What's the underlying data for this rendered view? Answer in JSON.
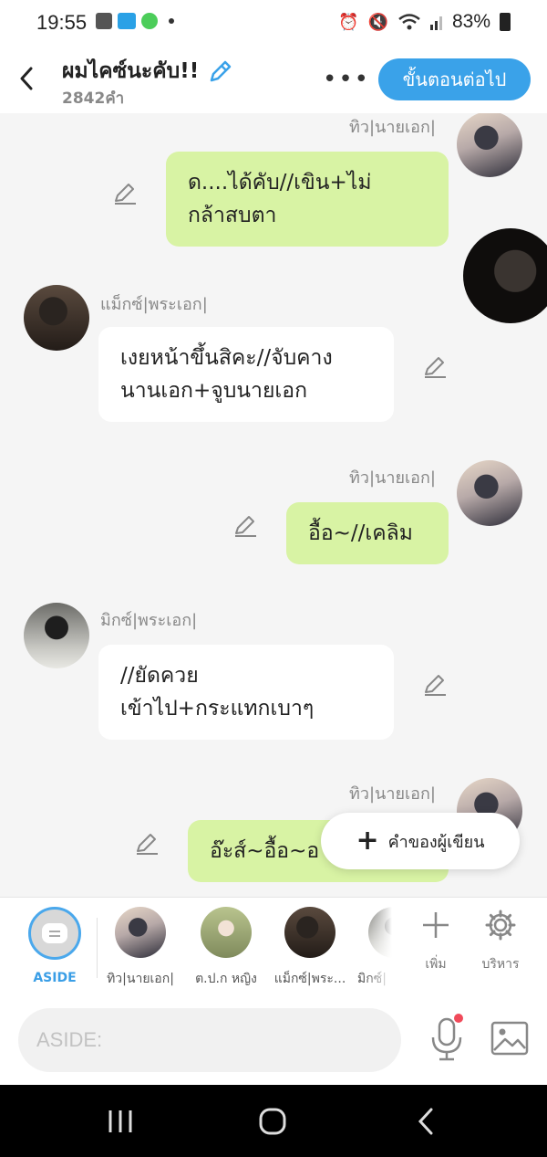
{
  "status_bar": {
    "time": "19:55",
    "battery": "83%",
    "icons": [
      "gallery-icon",
      "webtoon-icon",
      "line-icon",
      "alarm-icon",
      "mute-icon",
      "wifi-icon",
      "signal-icon",
      "battery-icon"
    ]
  },
  "header": {
    "title": "ผมไคซ์นะคับ!!",
    "word_count": "2842คำ",
    "more_label": "•••",
    "next_button": "ขั้นตอนต่อไป"
  },
  "messages": [
    {
      "sender": "ทิว|นายเอก|",
      "text_lines": [
        "ด....ได้คับ//เขิน+ไม่",
        "กล้าสบตา"
      ],
      "side": "right"
    },
    {
      "sender": "แม็กซ์|พระเอก|",
      "text_lines": [
        "เงยหน้าขึ้นสิคะ//จับคาง",
        "นานเอก+จูบนายเอก"
      ],
      "side": "left"
    },
    {
      "sender": "ทิว|นายเอก|",
      "text_lines": [
        "อื้อ~//เคลิม"
      ],
      "side": "right"
    },
    {
      "sender": "มิกซ์|พระเอก|",
      "text_lines": [
        "//ยัดควย",
        "เข้าไป+กระแทกเบาๆ"
      ],
      "side": "left"
    },
    {
      "sender": "ทิว|นายเอก|",
      "text_lines": [
        "อ๊ะส์~อื้อ~อ"
      ],
      "side": "right"
    }
  ],
  "fab": {
    "label": "คำของผู้เขียน",
    "icon": "plus-icon"
  },
  "characters": [
    {
      "label": "ASIDE"
    },
    {
      "label": "ทิว|นายเอก|"
    },
    {
      "label": "ต.ป.ก หญิง"
    },
    {
      "label": "แม็กซ์|พระ..."
    },
    {
      "label": "มิกซ์|"
    }
  ],
  "tools": {
    "add_label": "เพิ่ม",
    "manage_label": "บริหาร"
  },
  "input": {
    "placeholder": "ASIDE:"
  },
  "colors": {
    "accent": "#3aa2e9",
    "bubble_green": "#d8f3a4",
    "bubble_white": "#ffffff",
    "chat_bg": "#f5f5f5"
  }
}
